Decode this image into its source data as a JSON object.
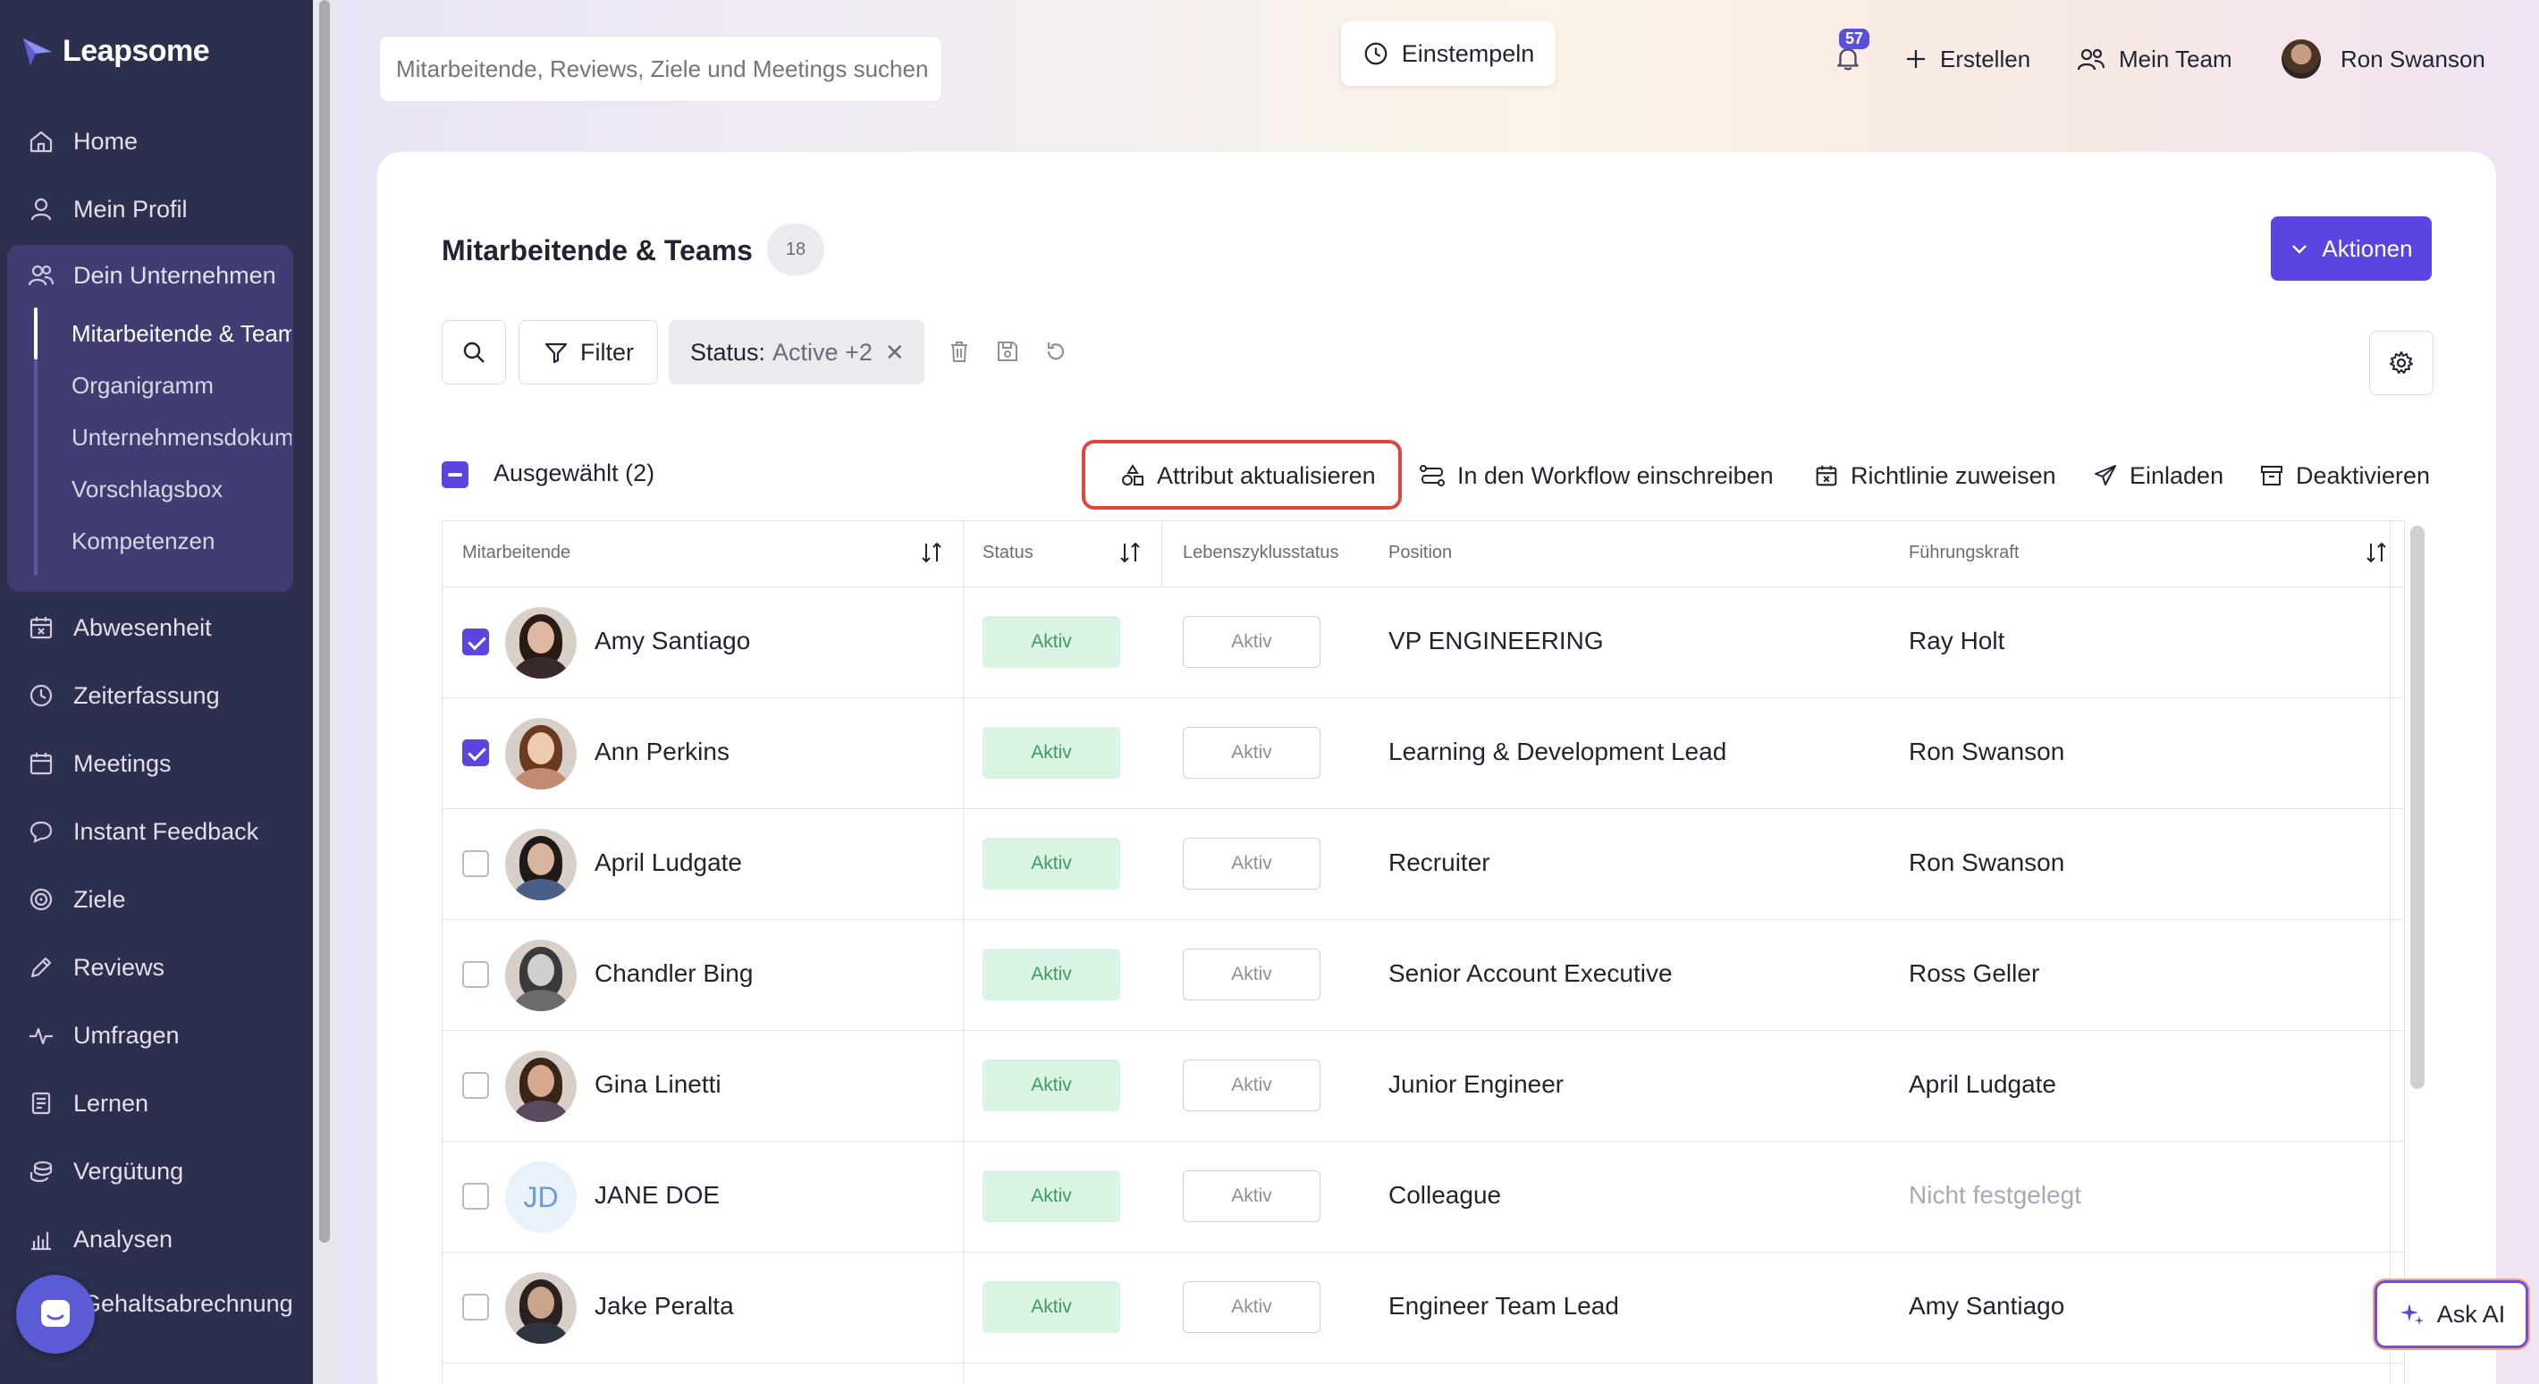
{
  "app": {
    "name": "Leapsome"
  },
  "sidebar": {
    "items": [
      {
        "key": "home",
        "label": "Home",
        "icon": "home-icon"
      },
      {
        "key": "profile",
        "label": "Mein Profil",
        "icon": "user-icon"
      },
      {
        "key": "company",
        "label": "Dein Unternehmen",
        "icon": "users-icon"
      },
      {
        "key": "absence",
        "label": "Abwesenheit",
        "icon": "calendar-x-icon"
      },
      {
        "key": "time",
        "label": "Zeiterfassung",
        "icon": "clock-icon"
      },
      {
        "key": "meetings",
        "label": "Meetings",
        "icon": "calendar-icon"
      },
      {
        "key": "feedback",
        "label": "Instant Feedback",
        "icon": "chat-bubble-icon"
      },
      {
        "key": "goals",
        "label": "Ziele",
        "icon": "target-icon"
      },
      {
        "key": "reviews",
        "label": "Reviews",
        "icon": "pen-icon"
      },
      {
        "key": "surveys",
        "label": "Umfragen",
        "icon": "pulse-icon"
      },
      {
        "key": "learning",
        "label": "Lernen",
        "icon": "book-icon"
      },
      {
        "key": "compensation",
        "label": "Vergütung",
        "icon": "coins-icon"
      },
      {
        "key": "analytics",
        "label": "Analysen",
        "icon": "bar-chart-icon"
      },
      {
        "key": "payroll",
        "label": "Gehaltsabrechnung",
        "icon": "payroll-icon"
      }
    ],
    "company_sub": [
      {
        "label": "Mitarbeitende & Teams",
        "active": true
      },
      {
        "label": "Organigramm",
        "active": false
      },
      {
        "label": "Unternehmensdokumente",
        "active": false
      },
      {
        "label": "Vorschlagsbox",
        "active": false
      },
      {
        "label": "Kompetenzen",
        "active": false
      }
    ]
  },
  "topbar": {
    "search_placeholder": "Mitarbeitende, Reviews, Ziele und Meetings suchen",
    "clockin_label": "Einstempeln",
    "notifications_count": "57",
    "create_label": "Erstellen",
    "team_label": "Mein Team",
    "user_name": "Ron Swanson"
  },
  "page": {
    "title": "Mitarbeitende & Teams",
    "count": "18",
    "actions_label": "Aktionen"
  },
  "toolbar": {
    "filter_label": "Filter",
    "status_label": "Status:",
    "status_value": "Active +2"
  },
  "bulk": {
    "selected_label": "Ausgewählt (2)",
    "actions": [
      {
        "key": "update-attribute",
        "label": "Attribut aktualisieren",
        "icon": "shapes-icon"
      },
      {
        "key": "workflow",
        "label": "In den Workflow einschreiben",
        "icon": "workflow-icon"
      },
      {
        "key": "policy",
        "label": "Richtlinie zuweisen",
        "icon": "calendar-x-icon"
      },
      {
        "key": "invite",
        "label": "Einladen",
        "icon": "send-icon"
      },
      {
        "key": "deactivate",
        "label": "Deaktivieren",
        "icon": "archive-icon"
      }
    ]
  },
  "table": {
    "headers": {
      "employee": "Mitarbeitende",
      "status": "Status",
      "lifecycle": "Lebenszyklusstatus",
      "position": "Position",
      "manager": "Führungskraft"
    },
    "rows": [
      {
        "name": "Amy Santiago",
        "checked": true,
        "status": "Aktiv",
        "lifecycle": "Aktiv",
        "position": "VP ENGINEERING",
        "manager": "Ray Holt",
        "avatar": "photo",
        "skin": "#e0b9a2",
        "hair": "#2a1a14",
        "shirt": "#3b2a2a"
      },
      {
        "name": "Ann Perkins",
        "checked": true,
        "status": "Aktiv",
        "lifecycle": "Aktiv",
        "position": "Learning & Development Lead",
        "manager": "Ron Swanson",
        "avatar": "photo",
        "skin": "#efc9b0",
        "hair": "#6a3a20",
        "shirt": "#c28b70"
      },
      {
        "name": "April Ludgate",
        "checked": false,
        "status": "Aktiv",
        "lifecycle": "Aktiv",
        "position": "Recruiter",
        "manager": "Ron Swanson",
        "avatar": "photo",
        "skin": "#d9b49c",
        "hair": "#1e1a1a",
        "shirt": "#4b5f86"
      },
      {
        "name": "Chandler Bing",
        "checked": false,
        "status": "Aktiv",
        "lifecycle": "Aktiv",
        "position": "Senior Account Executive",
        "manager": "Ross Geller",
        "avatar": "photo",
        "skin": "#cfcfcf",
        "hair": "#3a3a3a",
        "shirt": "#6b6b6b"
      },
      {
        "name": "Gina Linetti",
        "checked": false,
        "status": "Aktiv",
        "lifecycle": "Aktiv",
        "position": "Junior Engineer",
        "manager": "April Ludgate",
        "avatar": "photo",
        "skin": "#d6a98e",
        "hair": "#3a2418",
        "shirt": "#5a4a5e"
      },
      {
        "name": "JANE DOE",
        "checked": false,
        "status": "Aktiv",
        "lifecycle": "Aktiv",
        "position": "Colleague",
        "manager": "Nicht festgelegt",
        "manager_unset": true,
        "avatar": "initials",
        "initials": "JD"
      },
      {
        "name": "Jake Peralta",
        "checked": false,
        "status": "Aktiv",
        "lifecycle": "Aktiv",
        "position": "Engineer Team Lead",
        "manager": "Amy Santiago",
        "avatar": "photo",
        "skin": "#c9a48a",
        "hair": "#2a2220",
        "shirt": "#2e3440"
      }
    ]
  },
  "assistant": {
    "label": "Ask AI"
  },
  "colors": {
    "accent": "#5b45e0",
    "sidebar": "#2c2f4d",
    "highlight": "#e2463a",
    "status_green": "#d9f4e3"
  }
}
